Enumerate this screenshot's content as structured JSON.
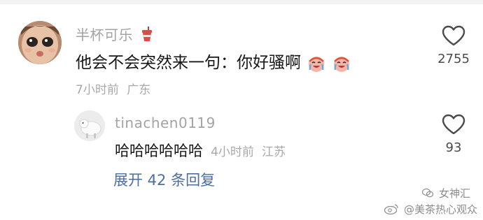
{
  "comment": {
    "username": "半杯可乐",
    "username_emoji": "cup-drink-icon",
    "text": "他会不会突然来一句：你好骚啊",
    "trailing_emojis": [
      "crying-laughing-face-icon",
      "crying-laughing-face-icon"
    ],
    "time": "7小时前",
    "location": "广东",
    "like_count": "2755"
  },
  "reply": {
    "username": "tinachen0119",
    "text": "哈哈哈哈哈哈",
    "time": "4小时前",
    "location": "江苏",
    "like_count": "93"
  },
  "expand_replies": "展开 42 条回复",
  "watermark": {
    "line1": "女神汇",
    "line2": "@美茶热心观众"
  },
  "colors": {
    "username": "#a3a3a3",
    "text": "#161616",
    "meta": "#a8a8a8",
    "link": "#4d6e9e",
    "icon": "#4a4a4a"
  }
}
